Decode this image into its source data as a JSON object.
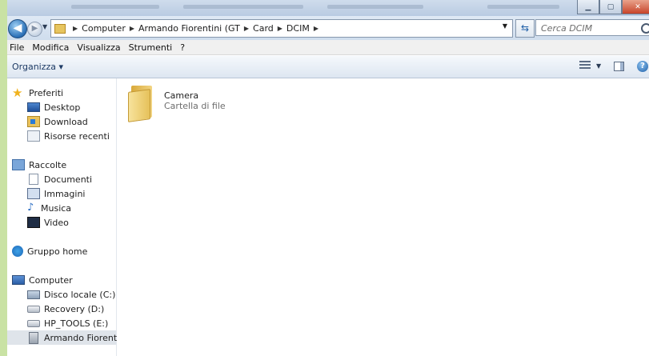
{
  "address": {
    "crumbs": [
      "Computer",
      "Armando Fiorentini (GT",
      "Card",
      "DCIM"
    ]
  },
  "search": {
    "placeholder": "Cerca DCIM"
  },
  "menu": [
    "File",
    "Modifica",
    "Visualizza",
    "Strumenti",
    "?"
  ],
  "command": {
    "organize_label": "Organizza ▾"
  },
  "nav": {
    "favorites": {
      "label": "Preferiti",
      "items": [
        "Desktop",
        "Download",
        "Risorse recenti"
      ]
    },
    "libraries": {
      "label": "Raccolte",
      "items": [
        "Documenti",
        "Immagini",
        "Musica",
        "Video"
      ]
    },
    "homegroup": {
      "label": "Gruppo home"
    },
    "computer": {
      "label": "Computer",
      "items": [
        "Disco locale (C:)",
        "Recovery (D:)",
        "HP_TOOLS (E:)",
        "Armando Fiorentini"
      ]
    }
  },
  "content": {
    "items": [
      {
        "name": "Camera",
        "type": "Cartella di file"
      }
    ]
  },
  "colors": {
    "background": "#c9e2a4",
    "selected": "#dfe4ea",
    "accent": "#1e5fa8"
  }
}
